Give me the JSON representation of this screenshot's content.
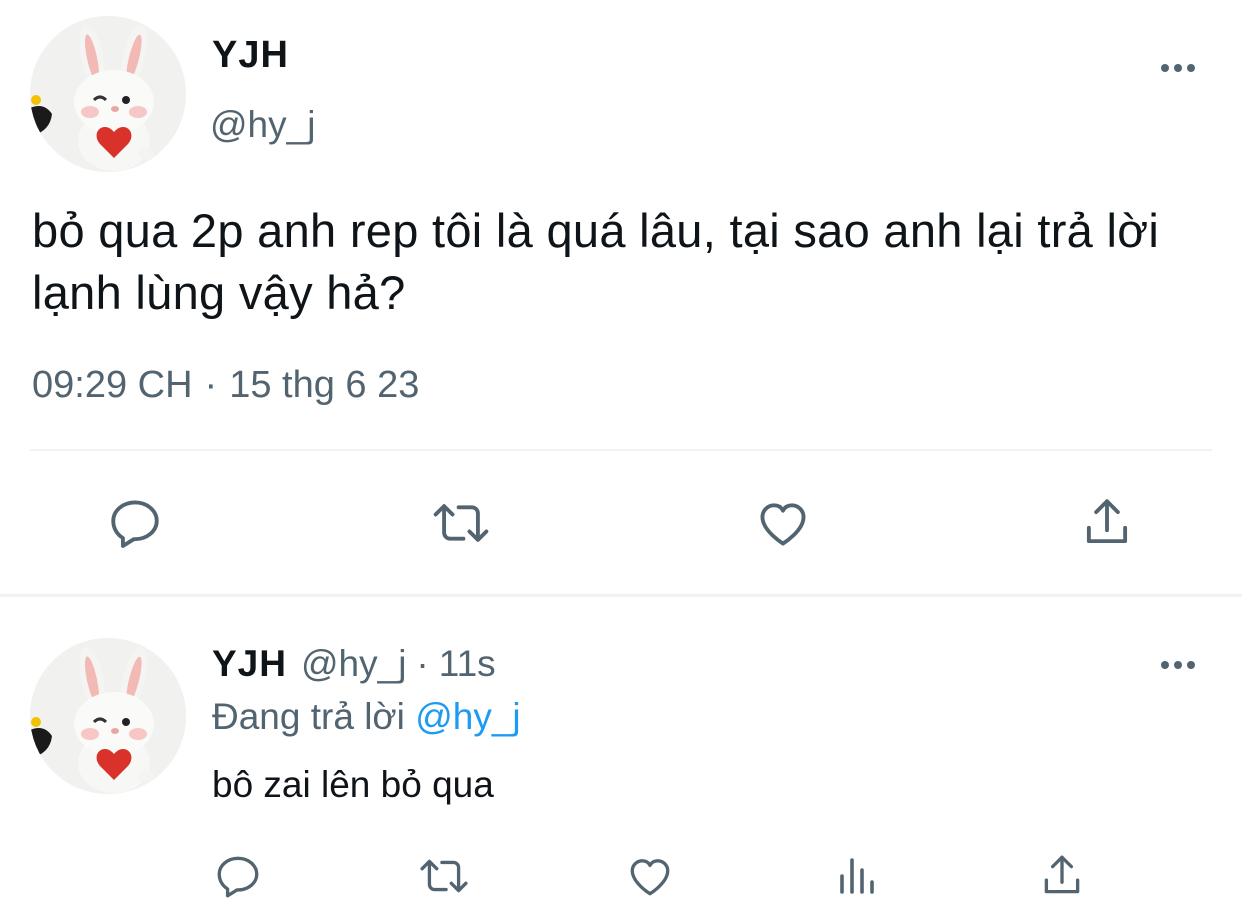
{
  "tweet": {
    "author_name": "YJH",
    "author_handle": "@hy_j",
    "text": "bỏ qua 2p anh rep tôi là quá lâu, tại sao anh lại trả lời lạnh lùng vậy hả?",
    "time": "09:29 CH",
    "separator": "·",
    "date": "15 thg 6 23",
    "more_icon": "more-horizontal-icon",
    "actions": [
      "reply-icon",
      "retweet-icon",
      "like-icon",
      "share-icon"
    ]
  },
  "reply": {
    "author_name": "YJH",
    "author_handle": "@hy_j",
    "separator": "·",
    "time": "11s",
    "replying_prefix": "Đang trả lời",
    "replying_to": "@hy_j",
    "text": "bô zai lên bỏ qua",
    "more_icon": "more-horizontal-icon",
    "actions": [
      "reply-icon",
      "retweet-icon",
      "like-icon",
      "analytics-icon",
      "share-icon"
    ]
  },
  "colors": {
    "text_primary": "#0f1419",
    "text_secondary": "#536471",
    "link": "#1d9bf0",
    "divider": "#eff3f4"
  }
}
